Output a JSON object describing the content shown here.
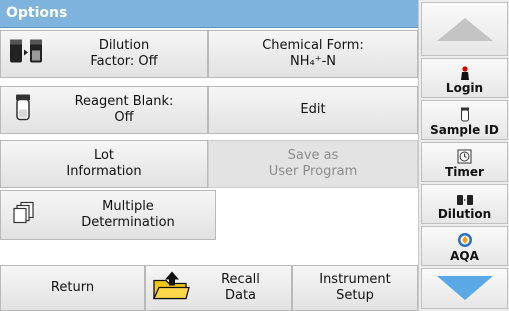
{
  "title": "Options",
  "buttons": {
    "dilution": "Dilution\nFactor: Off",
    "chemical_form_label": "Chemical Form:",
    "chemical_form_value": "NH₄⁺-N",
    "reagent_blank": "Reagent Blank:\nOff",
    "edit": "Edit",
    "lot_information": "Lot\nInformation",
    "save_user_program": "Save as\nUser Program",
    "multiple_determination": "Multiple\nDetermination"
  },
  "bottom_bar": {
    "return": "Return",
    "recall_data": "Recall\nData",
    "instrument_setup": "Instrument\nSetup"
  },
  "sidebar": {
    "login": "Login",
    "sample_id": "Sample ID",
    "timer": "Timer",
    "dilution": "Dilution",
    "aqa": "AQA"
  },
  "colors": {
    "title_bar": "#7db3dc",
    "arrow": "#5aa9e6"
  }
}
